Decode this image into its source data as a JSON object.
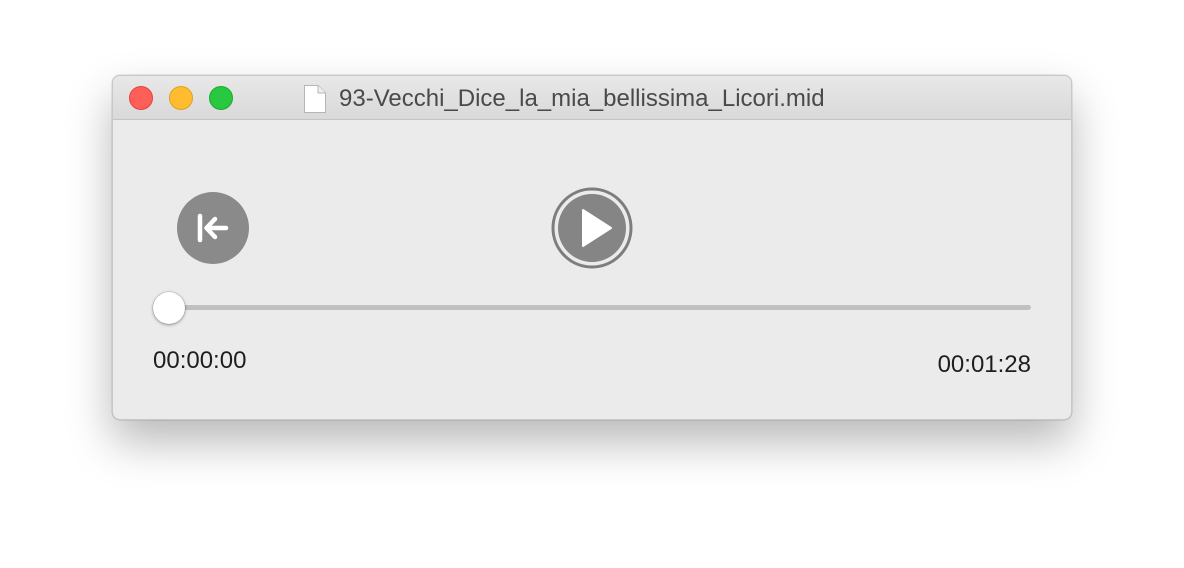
{
  "window": {
    "title": "93-Vecchi_Dice_la_mia_bellissima_Licori.mid",
    "title_icon": "document-icon"
  },
  "controls": {
    "back_icon": "skip-to-start-icon",
    "play_icon": "play-icon"
  },
  "playback": {
    "current_time": "00:00:00",
    "total_time": "00:01:28",
    "progress_fraction": 0
  },
  "colors": {
    "close": "#fe5f57",
    "minimize": "#febc2e",
    "zoom": "#28c840",
    "button_gray": "#8a8a8a",
    "track": "#c0c0c0"
  }
}
